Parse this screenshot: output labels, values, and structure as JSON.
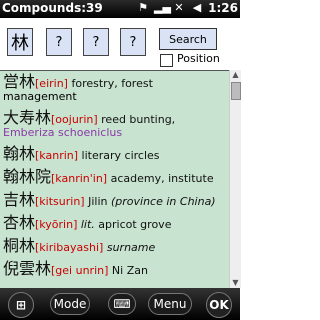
{
  "status_bar": {
    "title": "Compounds:39",
    "clock": "1:26",
    "icons": [
      "flag-icon",
      "signal-icon",
      "no-data-icon",
      "volume-mute-icon"
    ]
  },
  "query": {
    "boxes": [
      "林",
      "?",
      "?",
      "?"
    ],
    "search_label": "Search",
    "position_label": "Position",
    "position_checked": false
  },
  "results": [
    {
      "hanzi": "営林",
      "reading": "[eirin]",
      "gloss": "forestry, forest",
      "gloss2": "management"
    },
    {
      "hanzi": "大寿林",
      "reading": "[oojurin]",
      "gloss": "reed bunting,",
      "gloss2": "Emberiza schoeniclus"
    },
    {
      "hanzi": "翰林",
      "reading": "[kanrin]",
      "gloss": "literary circles"
    },
    {
      "hanzi": "翰林院",
      "reading": "[kanrin'in]",
      "gloss": "academy, institute"
    },
    {
      "hanzi": "吉林",
      "reading": "[kitsurin]",
      "gloss": "Jilin",
      "note": "(province in China)"
    },
    {
      "hanzi": "杏林",
      "reading": "[kyōrin]",
      "note": "lit.",
      "gloss": "apricot grove"
    },
    {
      "hanzi": "桐林",
      "reading": "[kiribayashi]",
      "note": "surname"
    },
    {
      "hanzi": "倪雲林",
      "reading": "[gei unrin]",
      "gloss": "Ni Zan"
    }
  ],
  "bottom_bar": {
    "mode_label": "Mode",
    "menu_label": "Menu",
    "ok_label": "OK"
  },
  "colors": {
    "list_bg": "#c8e3cf",
    "reading": "#cc0000",
    "latin_name": "#8b3aa8",
    "query_box": "#d9e3f5"
  }
}
